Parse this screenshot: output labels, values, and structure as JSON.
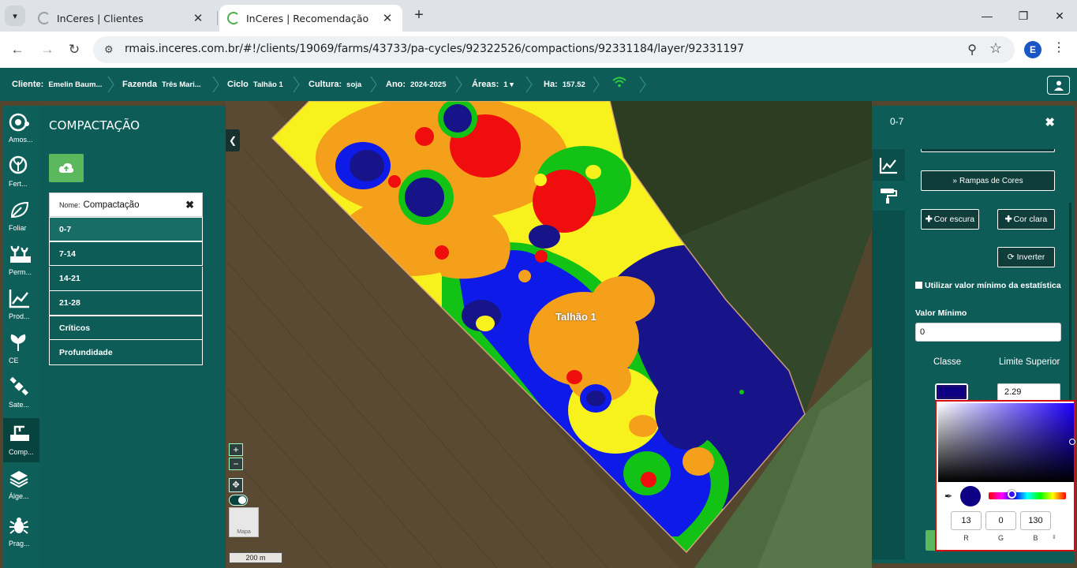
{
  "browser": {
    "tabs": [
      {
        "title": "InCeres | Clientes"
      },
      {
        "title": "InCeres | Recomendação"
      }
    ],
    "url": "rmais.inceres.com.br/#!/clients/19069/farms/43733/pa-cycles/92322526/compactions/92331184/layer/92331197",
    "profile_initial": "E"
  },
  "header": {
    "crumbs": [
      {
        "key": "Cliente:",
        "value": "Emelin Baum..."
      },
      {
        "key": "Fazenda",
        "value": "Três Mari..."
      },
      {
        "key": "Ciclo",
        "value": "Talhão 1"
      },
      {
        "key": "Cultura:",
        "value": "soja"
      },
      {
        "key": "Ano:",
        "value": "2024-2025"
      },
      {
        "key": "Áreas:",
        "value": "1 ▾"
      },
      {
        "key": "Ha:",
        "value": "157.52"
      }
    ]
  },
  "rail": [
    {
      "label": "Amos...",
      "icon": "samples-icon"
    },
    {
      "label": "Fert...",
      "icon": "fertility-icon"
    },
    {
      "label": "Foliar",
      "icon": "leaf-icon"
    },
    {
      "label": "Perm...",
      "icon": "permanent-crop-icon"
    },
    {
      "label": "Prod...",
      "icon": "productivity-chart-icon"
    },
    {
      "label": "CE",
      "icon": "plant-icon"
    },
    {
      "label": "Sate...",
      "icon": "satellite-icon"
    },
    {
      "label": "Comp...",
      "icon": "compaction-icon"
    },
    {
      "label": "Álge...",
      "icon": "layers-icon"
    },
    {
      "label": "Prag...",
      "icon": "pest-bug-icon"
    }
  ],
  "left_panel": {
    "title": "COMPACTAÇÃO",
    "name_key": "Nome:",
    "name_value": "Compactação",
    "layers": [
      "0-7",
      "7-14",
      "14-21",
      "21-28",
      "Críticos",
      "Profundidade"
    ],
    "selected_layer": "0-7"
  },
  "map": {
    "field_label": "Talhão 1",
    "zoom_in": "+",
    "zoom_out": "−",
    "basemap_label": "Mapa",
    "scale": "200 m",
    "colors": {
      "darkblue": "#17148a",
      "blue": "#0d1ae8",
      "green": "#12c214",
      "yellow": "#f7f21e",
      "orange": "#f5a01a",
      "red": "#f00d0d"
    }
  },
  "right_panel": {
    "title": "0-7",
    "ramp_button": "Rampas de Cores",
    "dark_button": "Cor escura",
    "light_button": "Cor clara",
    "invert_button": "Inverter",
    "use_min_stat": "Utilizar valor mínimo da estatística",
    "min_label": "Valor Mínimo",
    "min_value": "0",
    "class_header": "Classe",
    "limit_header": "Limite Superior",
    "limit_value": "2.29",
    "selected_color": "#0d0082"
  },
  "picker": {
    "r": "13",
    "g": "0",
    "b": "130",
    "r_label": "R",
    "g_label": "G",
    "b_label": "B"
  }
}
